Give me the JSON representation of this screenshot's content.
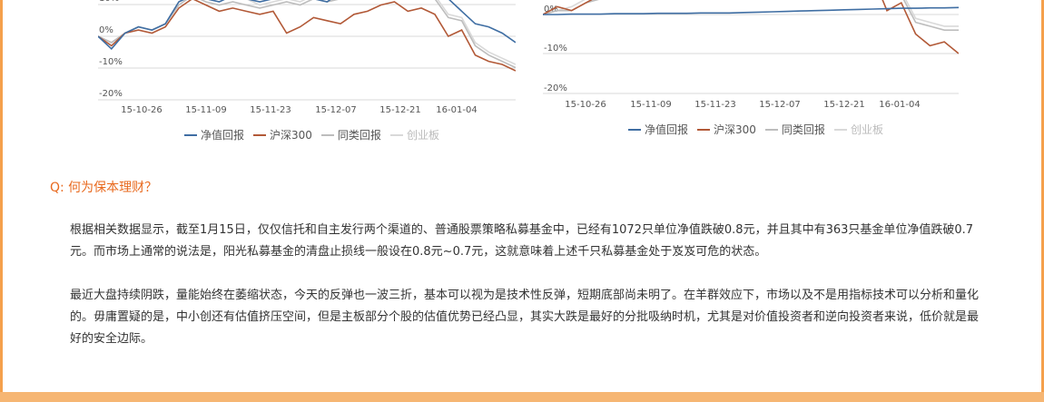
{
  "colors": {
    "nav": "#3f6ea3",
    "hs300": "#b25937",
    "peer": "#bdbdbd",
    "chinext": "#d9d9d9",
    "accent": "#e8691e",
    "frame": "#f5a04c"
  },
  "charts": [
    {
      "y_ticks": [
        "10%",
        "0%",
        "-10%",
        "-20%"
      ],
      "x_ticks": [
        "15-10-26",
        "15-11-09",
        "15-11-23",
        "15-12-07",
        "15-12-21",
        "16-01-04"
      ]
    },
    {
      "y_ticks": [
        "0%",
        "-10%",
        "-20%"
      ],
      "x_ticks": [
        "15-10-26",
        "15-11-09",
        "15-11-23",
        "15-12-07",
        "15-12-21",
        "16-01-04"
      ]
    }
  ],
  "legend": [
    {
      "label": "净值回报",
      "color_key": "nav"
    },
    {
      "label": "沪深300",
      "color_key": "hs300"
    },
    {
      "label": "同类回报",
      "color_key": "peer"
    },
    {
      "label": "创业板",
      "color_key": "chinext"
    }
  ],
  "chart_data": [
    {
      "type": "line",
      "title": "",
      "x_ticks": [
        "15-10-26",
        "15-11-09",
        "15-11-23",
        "15-12-07",
        "15-12-21",
        "16-01-04"
      ],
      "ylim": [
        -20,
        10
      ],
      "y_unit": "%",
      "series": [
        {
          "name": "净值回报",
          "values": [
            0,
            -4,
            1,
            3,
            2,
            4,
            11,
            13,
            12,
            11,
            13,
            12,
            11,
            12,
            14,
            13,
            12,
            11,
            14,
            13,
            12,
            14,
            13,
            14,
            16,
            14,
            12,
            8,
            4,
            3,
            1,
            -2
          ]
        },
        {
          "name": "沪深300",
          "values": [
            0,
            -3,
            1,
            2,
            1,
            3,
            9,
            12,
            10,
            8,
            9,
            8,
            7,
            8,
            1,
            3,
            6,
            5,
            4,
            7,
            8,
            10,
            11,
            8,
            9,
            7,
            0,
            2,
            -6,
            -8,
            -9,
            -11
          ]
        },
        {
          "name": "同类回报",
          "values": [
            0,
            -2,
            1,
            3,
            2,
            4,
            10,
            13,
            11,
            10,
            11,
            10,
            9,
            10,
            11,
            10,
            12,
            11,
            12,
            14,
            13,
            14,
            15,
            13,
            14,
            12,
            6,
            5,
            -3,
            -6,
            -8,
            -10
          ]
        },
        {
          "name": "创业板",
          "values": [
            0,
            -2,
            1,
            3,
            2,
            4,
            11,
            14,
            12,
            12,
            13,
            12,
            10,
            11,
            12,
            11,
            13,
            12,
            13,
            15,
            14,
            15,
            16,
            14,
            15,
            13,
            7,
            6,
            -2,
            -5,
            -7,
            -9
          ]
        }
      ]
    },
    {
      "type": "line",
      "title": "",
      "x_ticks": [
        "15-10-26",
        "15-11-09",
        "15-11-23",
        "15-12-07",
        "15-12-21",
        "16-01-04"
      ],
      "ylim": [
        -20,
        0
      ],
      "y_unit": "%",
      "series": [
        {
          "name": "净值回报",
          "values": [
            0,
            0,
            0.1,
            0.1,
            0.1,
            0.2,
            0.2,
            0.2,
            0.3,
            0.3,
            0.3,
            0.4,
            0.4,
            0.4,
            0.5,
            0.6,
            0.7,
            0.8,
            0.9,
            1,
            1.1,
            1.2,
            1.3,
            1.4,
            1.5,
            1.6,
            1.6,
            1.7,
            1.7,
            1.8
          ]
        },
        {
          "name": "沪深300",
          "values": [
            0,
            2,
            1,
            3,
            5,
            4,
            6,
            8,
            10,
            11,
            12,
            9,
            13,
            14,
            6,
            9,
            12,
            8,
            10,
            12,
            9,
            11,
            13,
            10,
            1,
            3,
            -5,
            -8,
            -7,
            -10
          ]
        },
        {
          "name": "同类回报",
          "values": [
            0,
            1,
            1,
            3,
            4,
            4,
            6,
            8,
            9,
            10,
            11,
            10,
            12,
            13,
            9,
            10,
            12,
            10,
            11,
            12,
            10,
            12,
            13,
            11,
            6,
            5,
            -2,
            -3,
            -4,
            -4
          ]
        },
        {
          "name": "创业板",
          "values": [
            0,
            1,
            2,
            4,
            5,
            5,
            7,
            9,
            10,
            11,
            12,
            11,
            13,
            14,
            10,
            11,
            13,
            11,
            12,
            13,
            11,
            13,
            14,
            12,
            7,
            6,
            -1,
            -2,
            -3,
            -3
          ]
        }
      ]
    }
  ],
  "question": "Q: 何为保本理财？",
  "paragraphs": [
    "根据相关数据显示，截至1月15日，仅仅信托和自主发行两个渠道的、普通股票策略私募基金中，已经有1072只单位净值跌破0.8元，并且其中有363只基金单位净值跌破0.7元。而市场上通常的说法是，阳光私募基金的清盘止损线一般设在0.8元~0.7元，这就意味着上述千只私募基金处于岌岌可危的状态。",
    "最近大盘持续阴跌，量能始终在萎缩状态，今天的反弹也一波三折，基本可以视为是技术性反弹，短期底部尚未明了。在羊群效应下，市场以及不是用指标技术可以分析和量化的。毋庸置疑的是，中小创还有估值挤压空间，但是主板部分个股的估值优势已经凸显，其实大跌是最好的分批吸纳时机，尤其是对价值投资者和逆向投资者来说，低价就是最好的安全边际。"
  ]
}
